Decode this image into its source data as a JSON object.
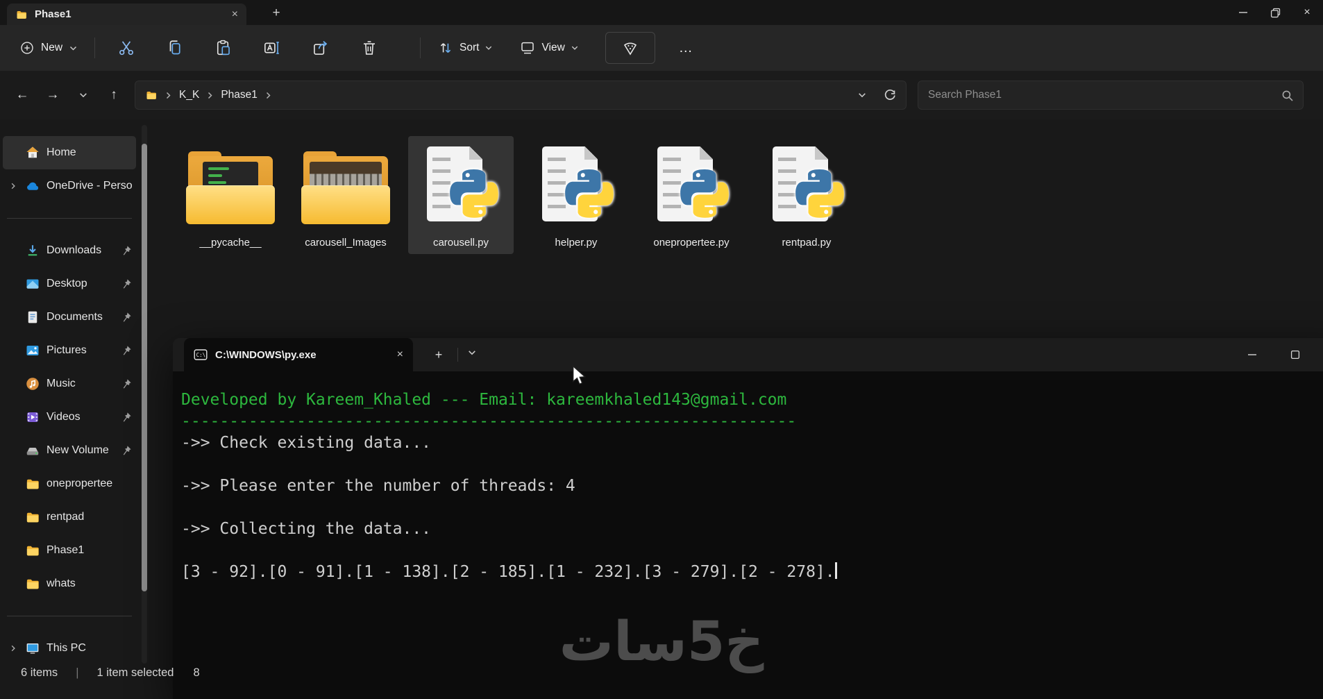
{
  "colors": {
    "terminal_green": "#2db83e",
    "terminal_bg": "#0c0c0c",
    "folder_yellow": "#f6ba30",
    "python_blue": "#3d76a8",
    "python_yellow": "#ffd43c",
    "selection_highlight": "#3a3a3a"
  },
  "explorer": {
    "tab": {
      "title": "Phase1",
      "new_tab_label": "+"
    },
    "toolbar": {
      "new_label": "New",
      "sort_label": "Sort",
      "view_label": "View",
      "more_label": "…",
      "icons": [
        "cut-icon",
        "copy-icon",
        "paste-icon",
        "rename-icon",
        "share-icon",
        "delete-icon",
        "sort-icon",
        "view-icon",
        "pizza-slice-icon",
        "ellipsis-icon"
      ]
    },
    "addressbar": {
      "crumbs": [
        "K_K",
        "Phase1"
      ]
    },
    "search_placeholder": "Search Phase1",
    "sidebar": {
      "items": [
        {
          "label": "Home",
          "icon": "home-icon",
          "selected": true
        },
        {
          "label": "OneDrive - Perso",
          "icon": "onedrive-icon",
          "expandable": true
        },
        {
          "label": "Downloads",
          "icon": "downloads-icon",
          "pinned": true
        },
        {
          "label": "Desktop",
          "icon": "desktop-icon",
          "pinned": true
        },
        {
          "label": "Documents",
          "icon": "documents-icon",
          "pinned": true
        },
        {
          "label": "Pictures",
          "icon": "pictures-icon",
          "pinned": true
        },
        {
          "label": "Music",
          "icon": "music-icon",
          "pinned": true
        },
        {
          "label": "Videos",
          "icon": "videos-icon",
          "pinned": true
        },
        {
          "label": "New Volume",
          "icon": "drive-icon",
          "pinned": true
        },
        {
          "label": "onepropertee",
          "icon": "folder-icon"
        },
        {
          "label": "rentpad",
          "icon": "folder-icon"
        },
        {
          "label": "Phase1",
          "icon": "folder-icon"
        },
        {
          "label": "whats",
          "icon": "folder-icon"
        },
        {
          "label": "This PC",
          "icon": "monitor-icon",
          "expandable": true
        }
      ]
    },
    "files": [
      {
        "name": "__pycache__",
        "icon": "folder-code-icon"
      },
      {
        "name": "carousell_Images",
        "icon": "folder-photos-icon"
      },
      {
        "name": "carousell.py",
        "icon": "python-file-icon",
        "selected": true
      },
      {
        "name": "helper.py",
        "icon": "python-file-icon"
      },
      {
        "name": "onepropertee.py",
        "icon": "python-file-icon"
      },
      {
        "name": "rentpad.py",
        "icon": "python-file-icon"
      }
    ],
    "statusbar": {
      "count": "6 items",
      "divider": "|",
      "selection": "1 item selected",
      "size_fragment": "8"
    }
  },
  "terminal": {
    "tab_title": "C:\\WINDOWS\\py.exe",
    "new_tab_label": "+",
    "lines": [
      {
        "style": "green",
        "text": "Developed by Kareem_Khaled --- Email: kareemkhaled143@gmail.com"
      },
      {
        "style": "green",
        "text": "----------------------------------------------------------------"
      },
      {
        "style": "plain",
        "text": "->> Check existing data..."
      },
      {
        "style": "plain",
        "text": ""
      },
      {
        "style": "plain",
        "text": "->> Please enter the number of threads: 4"
      },
      {
        "style": "plain",
        "text": ""
      },
      {
        "style": "plain",
        "text": "->> Collecting the data..."
      },
      {
        "style": "plain",
        "text": ""
      },
      {
        "style": "plain",
        "text": "[3 - 92].[0 - 91].[1 - 138].[2 - 185].[1 - 232].[3 - 279].[2 - 278].",
        "cursor": true
      }
    ]
  },
  "watermark": "خ5سات"
}
